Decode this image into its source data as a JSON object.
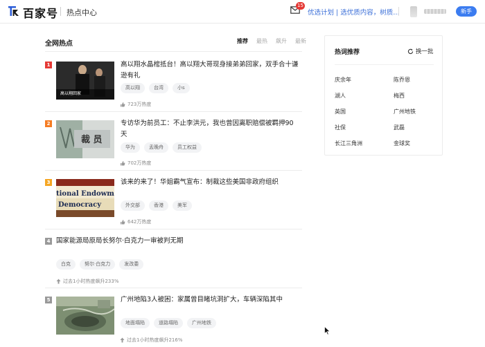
{
  "header": {
    "logo_text": "百家号",
    "page_name": "热点中心",
    "mail_badge": "15",
    "promo_text": "优选计划 | 选优质内容，树质…",
    "guide_button": "新手"
  },
  "main": {
    "section_title": "全网热点",
    "tabs": [
      {
        "label": "推荐",
        "active": true
      },
      {
        "label": "最热",
        "active": false
      },
      {
        "label": "飙升",
        "active": false
      },
      {
        "label": "最新",
        "active": false
      }
    ],
    "items": [
      {
        "rank": "1",
        "rank_color": "#e53935",
        "title_line1": "高以翔水晶棺抵台！高以翔大哥现身接弟弟回家，双手合十谦",
        "title_line2": "逊有礼",
        "tags": [
          "高以翔",
          "台湾",
          "小s"
        ],
        "heat": "723万热度",
        "thumb_caption": "高以翔回家"
      },
      {
        "rank": "2",
        "rank_color": "#f57c22",
        "title_line1": "专访华为前员工：不止李洪元，我也曾因离职赔偿被羁押90",
        "title_line2": "天",
        "tags": [
          "华为",
          "孟晚舟",
          "员工权益"
        ],
        "heat": "702万热度",
        "thumb_caption": "裁 员"
      },
      {
        "rank": "3",
        "rank_color": "#f5a623",
        "title_line1": "该来的来了！华姐霸气宣布：制裁这些美国非政府组织",
        "title_line2": "",
        "tags": [
          "外交部",
          "香港",
          "美军"
        ],
        "heat": "642万热度",
        "thumb_caption1": "tional Endowm",
        "thumb_caption2": "Democracy"
      },
      {
        "rank": "4",
        "rank_color": "#999999",
        "title_line1": "国家能源局原局长努尔·白克力一审被判无期",
        "title_line2": "",
        "tags": [
          "白克",
          "努尔·白克力",
          "发改委"
        ],
        "heat": "过去1小时热度飙升233%"
      },
      {
        "rank": "5",
        "rank_color": "#999999",
        "title_line1": "广州地陷3人被困：家属曾目睹坑洞扩大，车辆深陷其中",
        "title_line2": "",
        "tags": [
          "地面塌陷",
          "道路塌陷",
          "广州地铁"
        ],
        "heat": "过去1小时热度飙升216%"
      }
    ]
  },
  "side": {
    "title": "热词推荐",
    "refresh_label": "换一批",
    "keywords": [
      "庆余年",
      "陈乔恩",
      "湖人",
      "梅西",
      "英国",
      "广州地铁",
      "社保",
      "武磊",
      "长江三角洲",
      "金球奖"
    ]
  },
  "colors": {
    "accent": "#3b7cf0",
    "link": "#3b6fd8"
  }
}
